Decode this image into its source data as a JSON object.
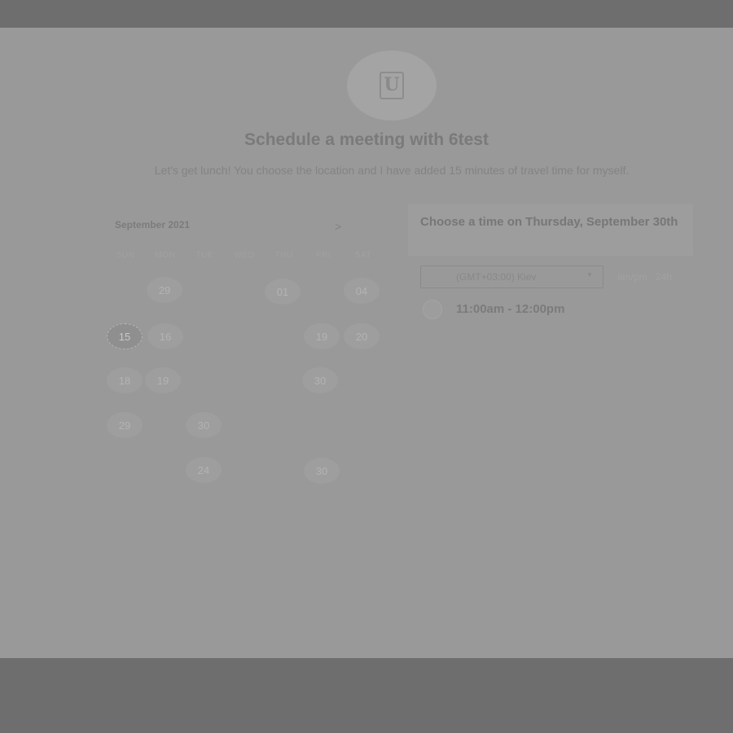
{
  "meeting": {
    "avatar_glyph": "U",
    "title": "Schedule a meeting with 6test",
    "description": "Let's get lunch! You choose the location and I have added 15 minutes of travel time for myself."
  },
  "calendar": {
    "month_label": "September 2021",
    "next_glyph": ">",
    "weekdays": [
      "SUN",
      "MON",
      "TUE",
      "WED",
      "THU",
      "FRI",
      "SAT"
    ],
    "days": [
      "29",
      "01",
      "04",
      "15",
      "16",
      "19",
      "20",
      "18",
      "19",
      "30",
      "29",
      "30",
      "24",
      "30"
    ],
    "today": "15"
  },
  "time_panel": {
    "heading": "Choose a time on Thursday, September 30th",
    "timezone": "(GMT+03:00) Kiev",
    "format_ampm": "am/pm",
    "format_24h": "24h",
    "slots": [
      {
        "label": "11:00am - 12:00pm"
      }
    ]
  }
}
